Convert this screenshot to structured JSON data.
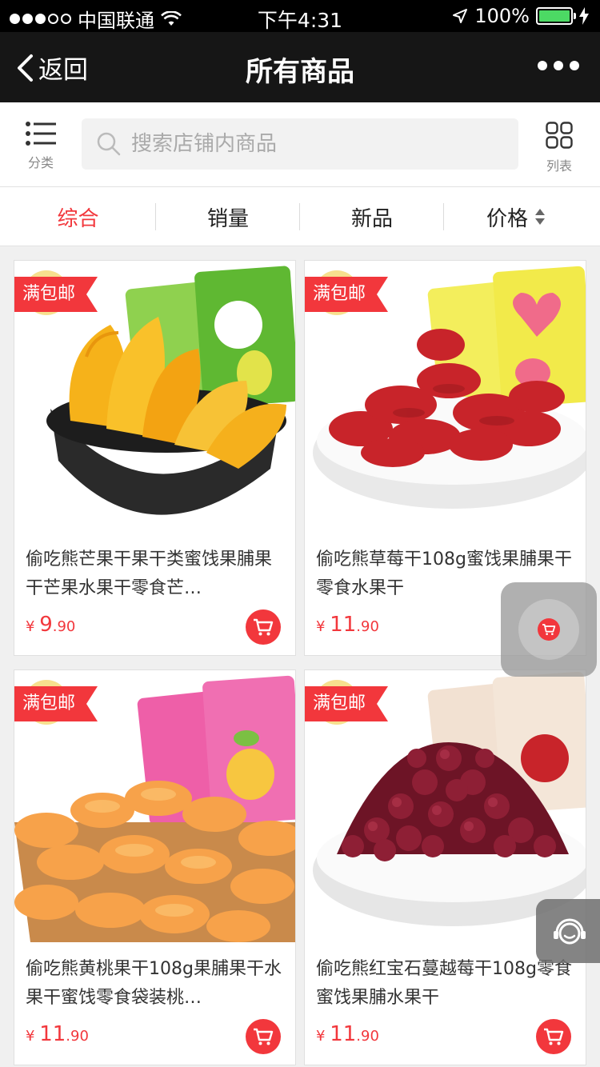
{
  "status_bar": {
    "carrier": "中国联通",
    "time": "下午4:31",
    "battery": "100%",
    "battery_level": 1.0
  },
  "nav": {
    "back_label": "返回",
    "title": "所有商品"
  },
  "toolbar": {
    "category_label": "分类",
    "search_placeholder": "搜索店铺内商品",
    "list_label": "列表"
  },
  "sort_tabs": [
    {
      "label": "综合",
      "active": true
    },
    {
      "label": "销量",
      "active": false
    },
    {
      "label": "新品",
      "active": false
    },
    {
      "label": "价格",
      "active": false
    }
  ],
  "products": [
    {
      "tag": "满包邮",
      "title": "偷吃熊芒果干果干类蜜饯果脯果干芒果水果干零食芒…",
      "currency": "¥",
      "price_int": "9",
      "price_dec": ".90",
      "image": "mango"
    },
    {
      "tag": "满包邮",
      "title": "偷吃熊草莓干108g蜜饯果脯果干零食水果干",
      "currency": "¥",
      "price_int": "11",
      "price_dec": ".90",
      "image": "strawberry"
    },
    {
      "tag": "满包邮",
      "title": "偷吃熊黄桃果干108g果脯果干水果干蜜饯零食袋装桃…",
      "currency": "¥",
      "price_int": "11",
      "price_dec": ".90",
      "image": "peach"
    },
    {
      "tag": "满包邮",
      "title": "偷吃熊红宝石蔓越莓干108g零食蜜饯果脯水果干",
      "currency": "¥",
      "price_int": "11",
      "price_dec": ".90",
      "image": "cranberry"
    }
  ],
  "colors": {
    "accent": "#f2373c",
    "nav_bg": "#161616"
  }
}
